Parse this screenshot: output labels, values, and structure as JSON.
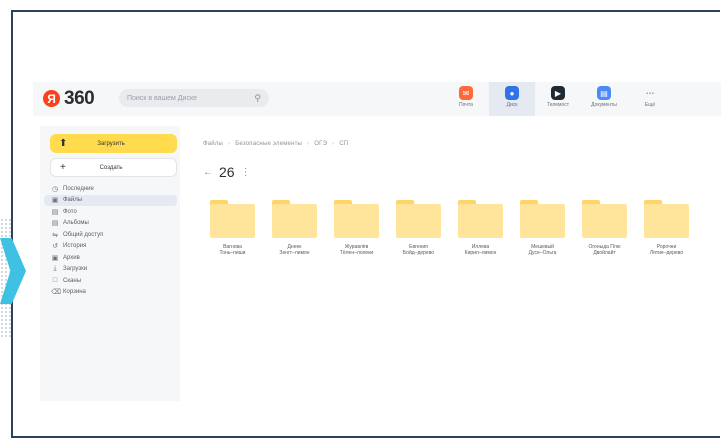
{
  "header": {
    "logo_letter": "Я",
    "logo_text": "360",
    "search_placeholder": "Поиск в вашем Диске",
    "search_icon": "search-icon",
    "apps": [
      {
        "name": "Почта",
        "icon": "mail-icon",
        "color": "#ff6a3d"
      },
      {
        "name": "Диск",
        "icon": "disk-icon",
        "color": "#2f73e6"
      },
      {
        "name": "Телемост",
        "icon": "telemost-icon",
        "color": "#1f2a33"
      },
      {
        "name": "Документы",
        "icon": "documents-icon",
        "color": "#4b8bf5"
      },
      {
        "name": "Ещё",
        "icon": "more-icon",
        "color": "#9aa0a8"
      }
    ]
  },
  "sidebar": {
    "upload_label": "Загрузить",
    "create_label": "Создать",
    "items": [
      {
        "label": "Последние",
        "icon": "clock-icon"
      },
      {
        "label": "Файлы",
        "icon": "files-icon"
      },
      {
        "label": "Фото",
        "icon": "photo-icon"
      },
      {
        "label": "Альбомы",
        "icon": "albums-icon"
      },
      {
        "label": "Общий доступ",
        "icon": "shared-icon"
      },
      {
        "label": "История",
        "icon": "history-icon"
      },
      {
        "label": "Архив",
        "icon": "archive-icon"
      },
      {
        "label": "Загрузки",
        "icon": "downloads-icon"
      },
      {
        "label": "Сканы",
        "icon": "scans-icon"
      },
      {
        "label": "Корзина",
        "icon": "trash-icon"
      }
    ],
    "active_index": 1
  },
  "main": {
    "breadcrumbs": [
      "Файлы",
      "Безопасные элементы",
      "ОГЭ",
      "СП"
    ],
    "title": "26",
    "folders": [
      {
        "line1": "Вагнова",
        "line2": "Тонь–пиши"
      },
      {
        "line1": "Днеек",
        "line2": "Зенгт–лимон"
      },
      {
        "line1": "Журавлёв",
        "line2": "Тёлен–лолеки"
      },
      {
        "line1": "Евгения",
        "line2": "Бойд–дерево"
      },
      {
        "line1": "Иллева",
        "line2": "Кирил–лимон"
      },
      {
        "line1": "Мешевый",
        "line2": "Дусе–Ольга"
      },
      {
        "line1": "Огоныда Плю",
        "line2": "Двойлайт"
      },
      {
        "line1": "Ророчни",
        "line2": "Лятие–дерево"
      }
    ]
  }
}
